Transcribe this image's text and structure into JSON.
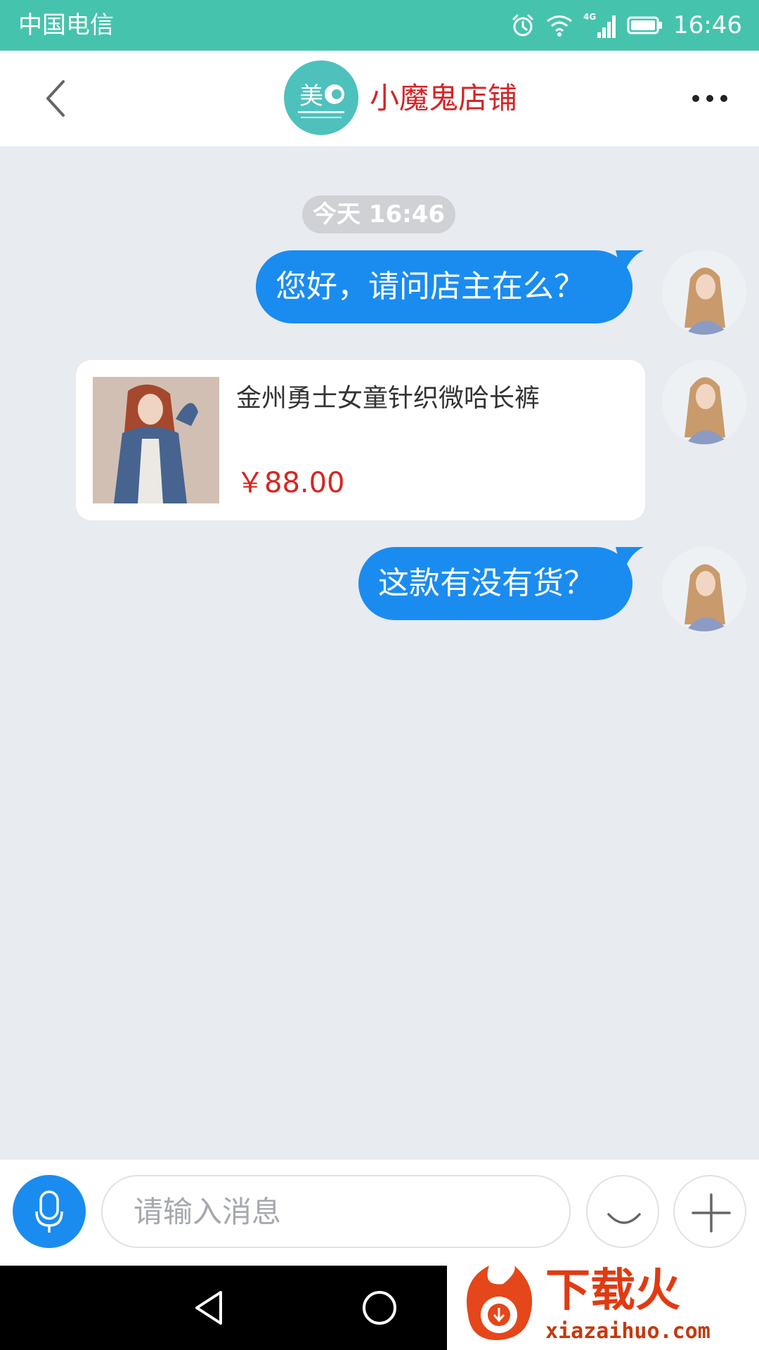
{
  "status_bar": {
    "carrier": "中国电信",
    "network": "4G",
    "time": "16:46",
    "icons": [
      "alarm-icon",
      "wifi-icon",
      "signal-icon",
      "battery-icon"
    ]
  },
  "header": {
    "shop_name": "小魔鬼店铺",
    "logo_text": "美",
    "icons": [
      "back-arrow-icon",
      "more-dots-icon"
    ]
  },
  "chat": {
    "time_label": "今天 16:46",
    "messages": [
      {
        "type": "text",
        "direction": "outgoing",
        "text": "您好，请问店主在么？"
      },
      {
        "type": "product",
        "direction": "outgoing",
        "title": "金州勇士女童针织微哈长裤",
        "price": "￥88.00"
      },
      {
        "type": "text",
        "direction": "outgoing",
        "text": "这款有没有货？"
      }
    ]
  },
  "input_bar": {
    "placeholder": "请输入消息",
    "icons": [
      "microphone-icon",
      "emoji-icon",
      "plus-icon"
    ]
  },
  "nav_bar": {
    "icons": [
      "nav-back-icon",
      "nav-home-icon"
    ]
  },
  "watermark": {
    "title": "下载火",
    "url": "xiazaihuo.com"
  },
  "colors": {
    "status_bar": "#46c3ad",
    "bubble": "#1a8cf0",
    "shop_name": "#d52527",
    "price": "#d7251f",
    "background": "#e8ebf0"
  }
}
